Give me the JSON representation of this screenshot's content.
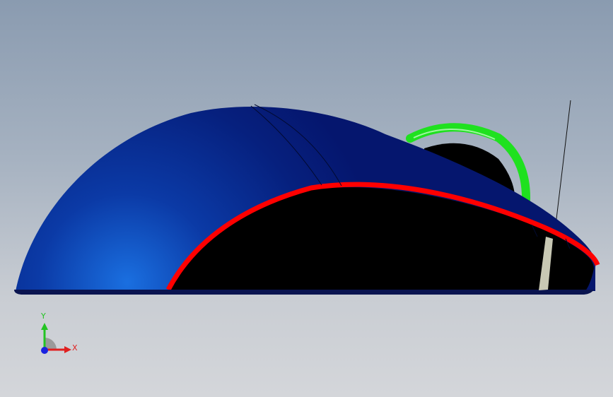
{
  "viewport": {
    "background_top": "#8a9bb0",
    "background_bottom": "#d4d6da"
  },
  "model": {
    "body_color": "#05166e",
    "body_highlight_color": "#1a6fe0",
    "split_line_color": "#ff0000",
    "wheel_color": "#1fe11f",
    "underside_color": "#000000",
    "foot_color": "#c8c8b4"
  },
  "triad": {
    "y_label": "Y",
    "x_label": "X",
    "y_color": "#23c423",
    "x_color": "#e02020",
    "z_color": "#1a22e0"
  }
}
